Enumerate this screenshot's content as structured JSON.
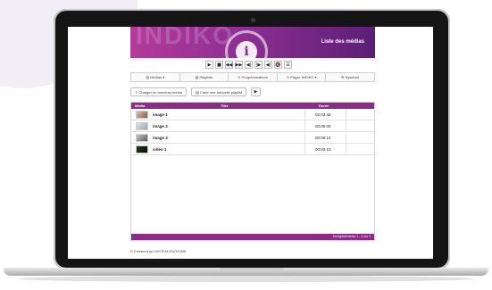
{
  "banner": {
    "watermark": "INDIKO",
    "logo_letter": "i",
    "title": "Liste des médias"
  },
  "player": {
    "buttons": [
      "▶",
      "■",
      "◀◀",
      "▶▶",
      "◀|",
      "|▶",
      "◀)",
      "🔇",
      "☰"
    ]
  },
  "menu": {
    "items": [
      "▤ Médias ▾",
      "▤ Playlists",
      "⊙ Programmations",
      "⊙ Player INDIKO ▾",
      "⚙ Système"
    ]
  },
  "actions": {
    "upload": "⇪ Charger un nouveau média",
    "new_playlist": "▤ Créer une nouvelle playlist",
    "play": "▶"
  },
  "table": {
    "headers": {
      "media": "Média",
      "title": "Titre",
      "duration": "Durée"
    },
    "rows": [
      {
        "name": "image 1",
        "duration": "02:03:45"
      },
      {
        "name": "image 2",
        "duration": "00:05:00"
      },
      {
        "name": "image 3",
        "duration": "00:00:10"
      },
      {
        "name": "vidéo 1",
        "duration": "00:00:10"
      }
    ],
    "footer": "Enregistrements 1 - 4 sur 4"
  },
  "footer": {
    "powered": "© Powered by IVISTEM EDITIONS"
  },
  "colors": {
    "accent": "#8c2c87",
    "banner_start": "#b43a9b",
    "banner_end": "#5c1e77"
  }
}
